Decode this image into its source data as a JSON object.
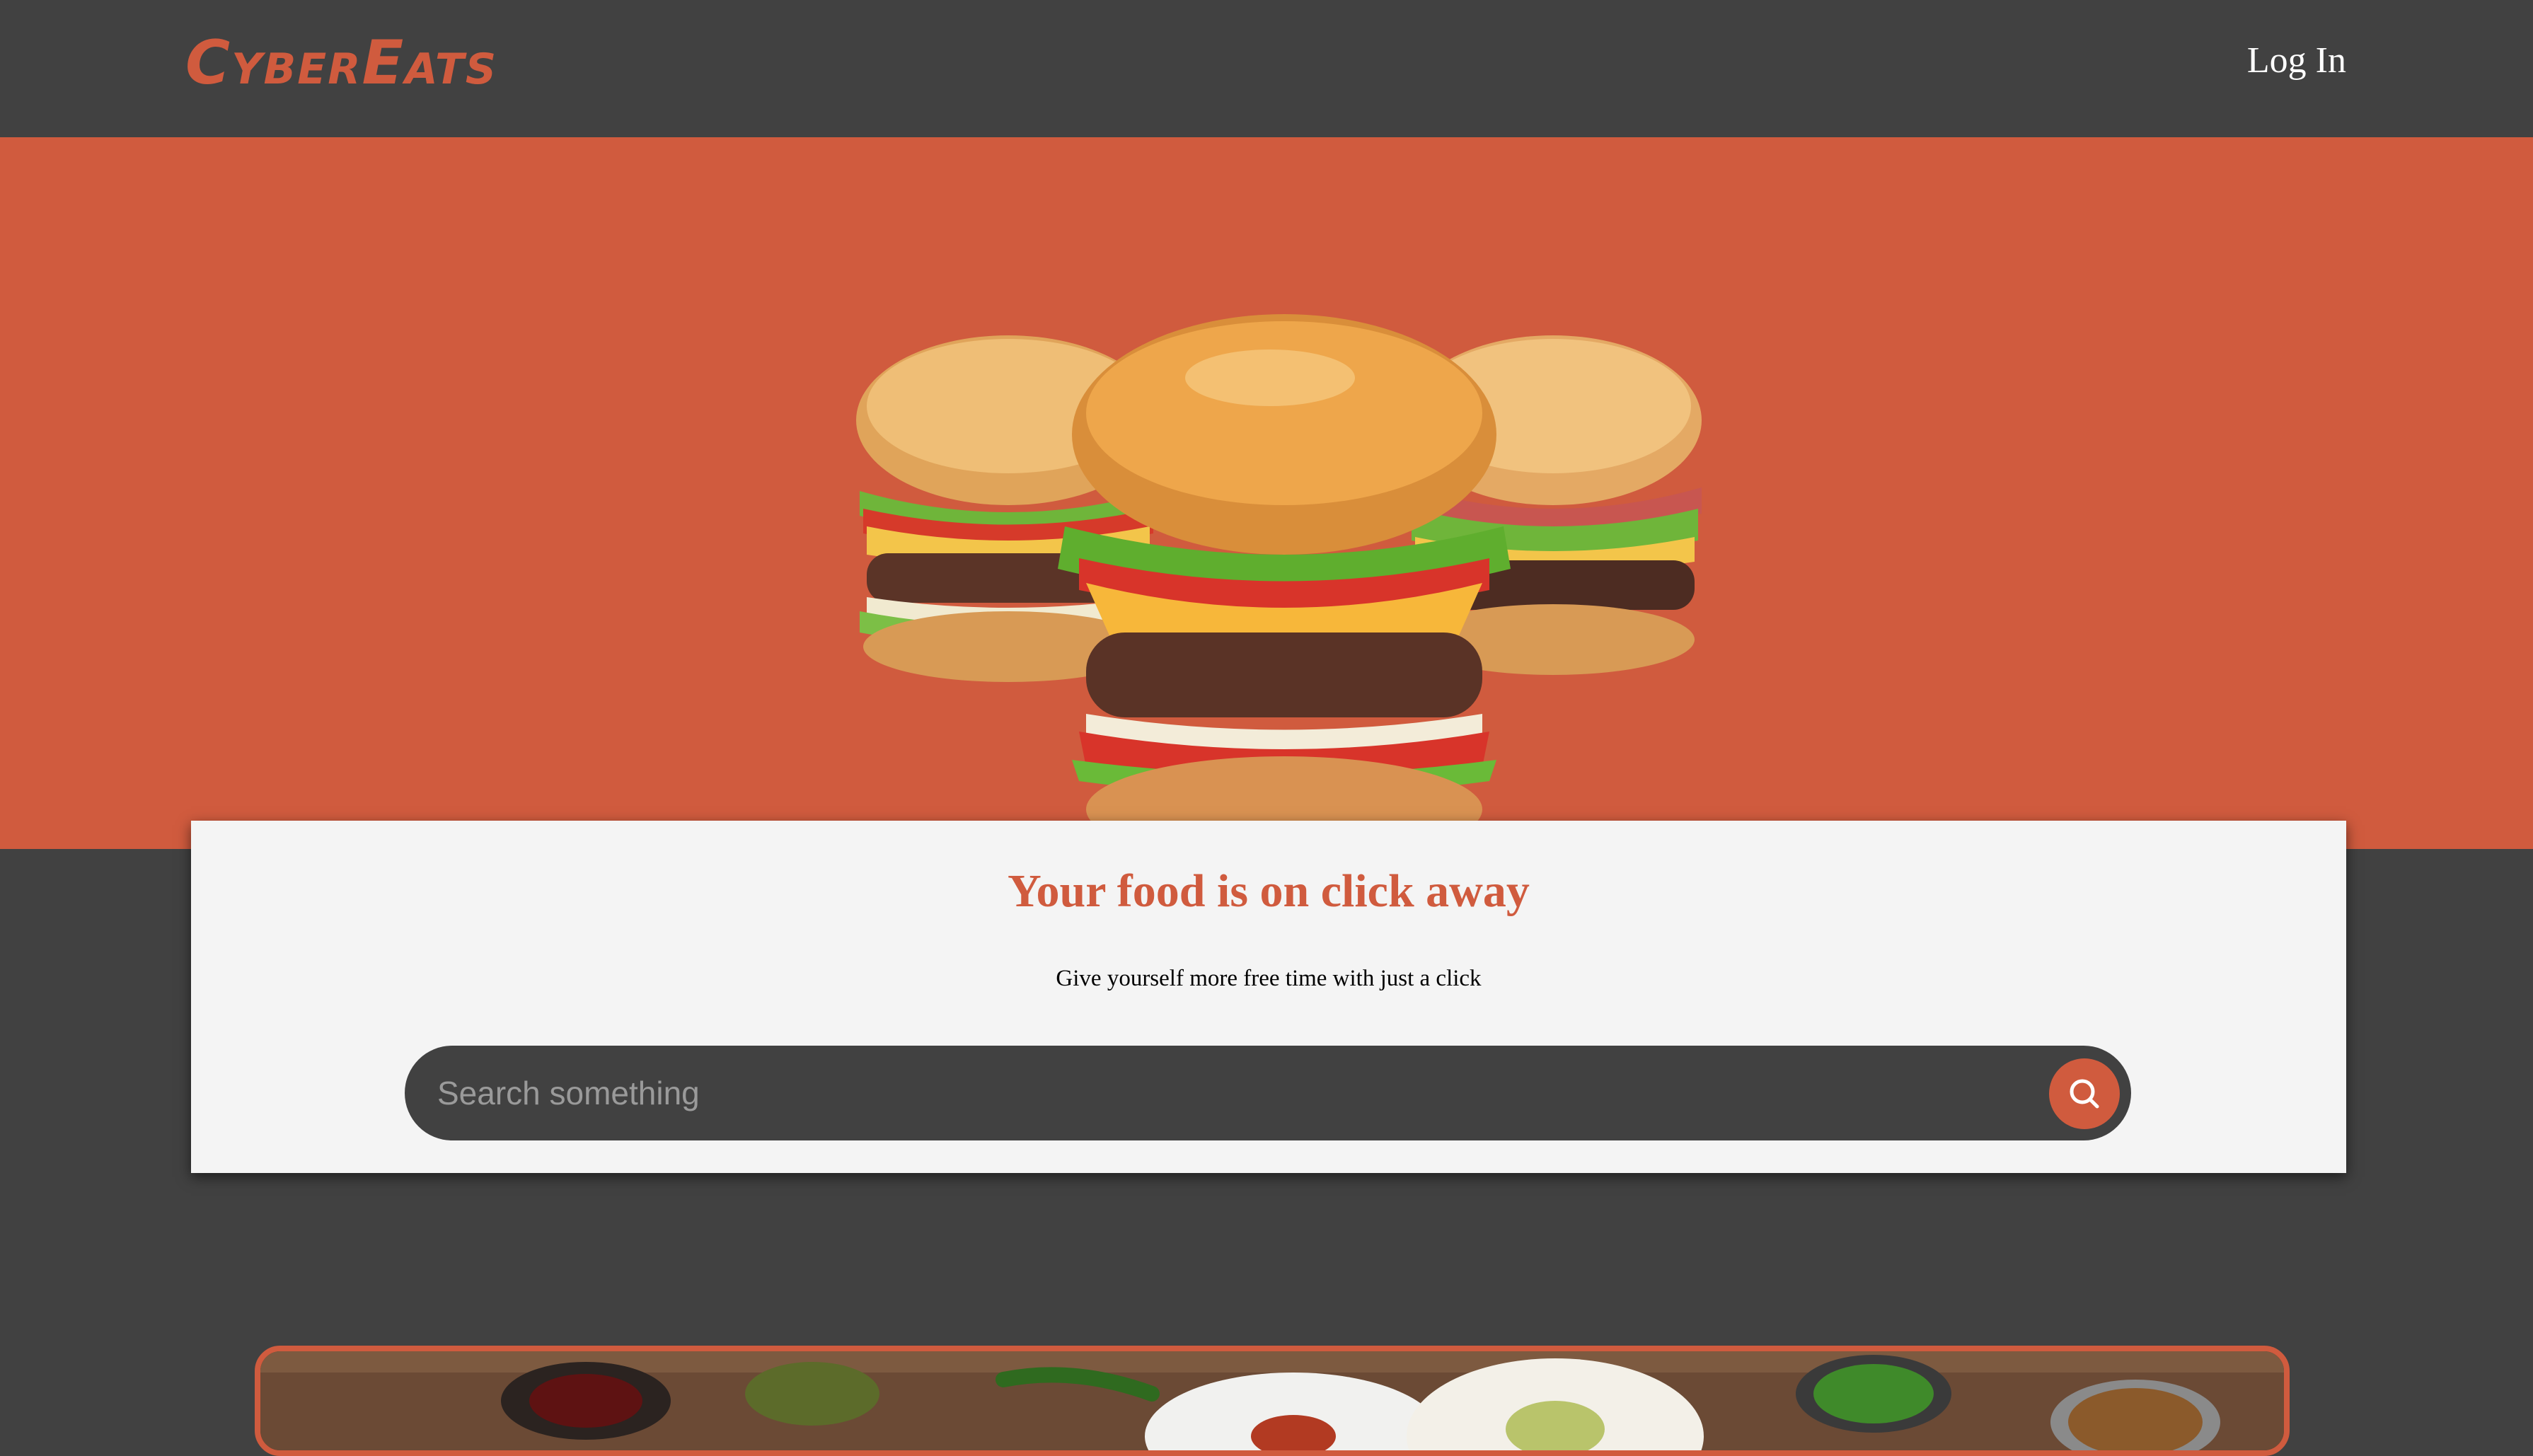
{
  "brand": {
    "name": "CyberEats",
    "accent_color": "#d05b3e",
    "dark_color": "#414141"
  },
  "nav": {
    "login_label": "Log In"
  },
  "hero": {
    "image_icon": "burgers-image"
  },
  "card": {
    "title": "Your food is on click away",
    "subtitle": "Give yourself more free time with just a click"
  },
  "search": {
    "placeholder": "Search something",
    "value": "",
    "button_icon": "search-icon"
  },
  "banner": {
    "image_icon": "spices-table-image"
  }
}
